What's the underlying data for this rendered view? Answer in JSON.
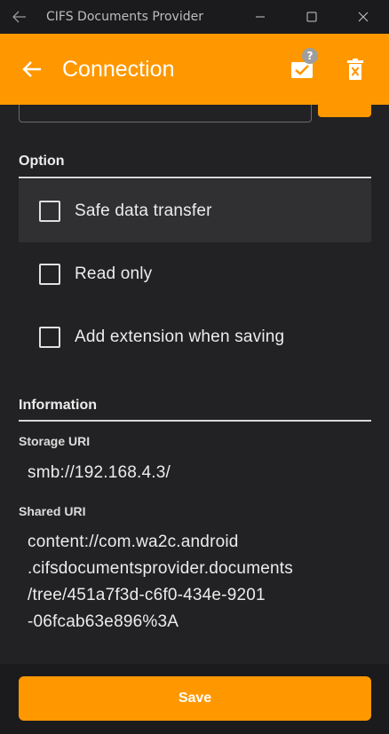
{
  "window": {
    "title": "CIFS Documents Provider"
  },
  "appbar": {
    "title": "Connection",
    "actions": [
      {
        "icon": "check-connection-icon",
        "badge": "?"
      },
      {
        "icon": "delete-icon"
      }
    ]
  },
  "options": {
    "section_title": "Option",
    "items": [
      {
        "label": "Safe data transfer",
        "checked": false
      },
      {
        "label": "Read only",
        "checked": false
      },
      {
        "label": "Add extension when saving",
        "checked": false
      }
    ]
  },
  "information": {
    "section_title": "Information",
    "storage_uri_label": "Storage URI",
    "storage_uri_value": "smb://192.168.4.3/",
    "shared_uri_label": "Shared URI",
    "shared_uri_value": "content://com.wa2c.android\n.cifsdocumentsprovider.documents\n/tree/451a7f3d-c6f0-434e-9201\n-06fcab63e896%3A"
  },
  "bottom": {
    "save_label": "Save"
  },
  "colors": {
    "accent": "#ff9800",
    "background": "#222224",
    "titlebar": "#1b1b1d"
  }
}
